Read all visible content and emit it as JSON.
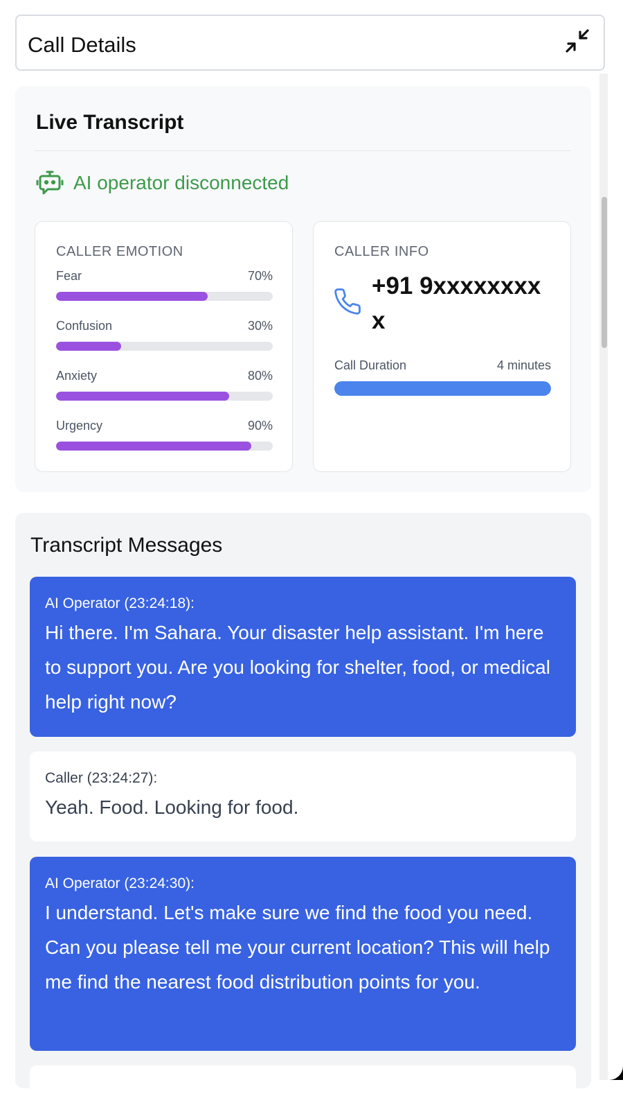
{
  "header": {
    "title": "Call Details",
    "collapse_icon": "collapse-arrows-icon"
  },
  "live": {
    "title": "Live Transcript",
    "status_icon": "bot-icon",
    "status_text": "AI operator disconnected",
    "status_color": "#3d9a4b"
  },
  "emotion": {
    "title": "CALLER EMOTION",
    "items": [
      {
        "label": "Fear",
        "value": "70%",
        "level": 0.7
      },
      {
        "label": "Confusion",
        "value": "30%",
        "level": 0.3
      },
      {
        "label": "Anxiety",
        "value": "80%",
        "level": 0.8
      },
      {
        "label": "Urgency",
        "value": "90%",
        "level": 0.9
      }
    ],
    "bar_color": "#9b51e0"
  },
  "info": {
    "title": "CALLER INFO",
    "phone_icon": "phone-icon",
    "phone": "+91 9xxxxxxxxx",
    "duration_label": "Call Duration",
    "duration_value": "4 minutes",
    "duration_level": 1.0,
    "bar_color": "#4a84ec"
  },
  "transcript": {
    "title": "Transcript Messages",
    "messages": [
      {
        "role": "ai",
        "header": "AI Operator (23:24:18):",
        "text": "Hi there. I'm Sahara. Your disaster help assistant. I'm here to support you. Are you looking for shelter, food, or medical help right now?"
      },
      {
        "role": "caller",
        "header": "Caller (23:24:27):",
        "text": "Yeah. Food. Looking for food."
      },
      {
        "role": "ai",
        "header": "AI Operator (23:24:30):",
        "text": "I understand. Let's make sure we find the food you need. Can you please tell me your current location? This will help me find the nearest food distribution points for you."
      }
    ],
    "ai_color": "#3862e1"
  }
}
